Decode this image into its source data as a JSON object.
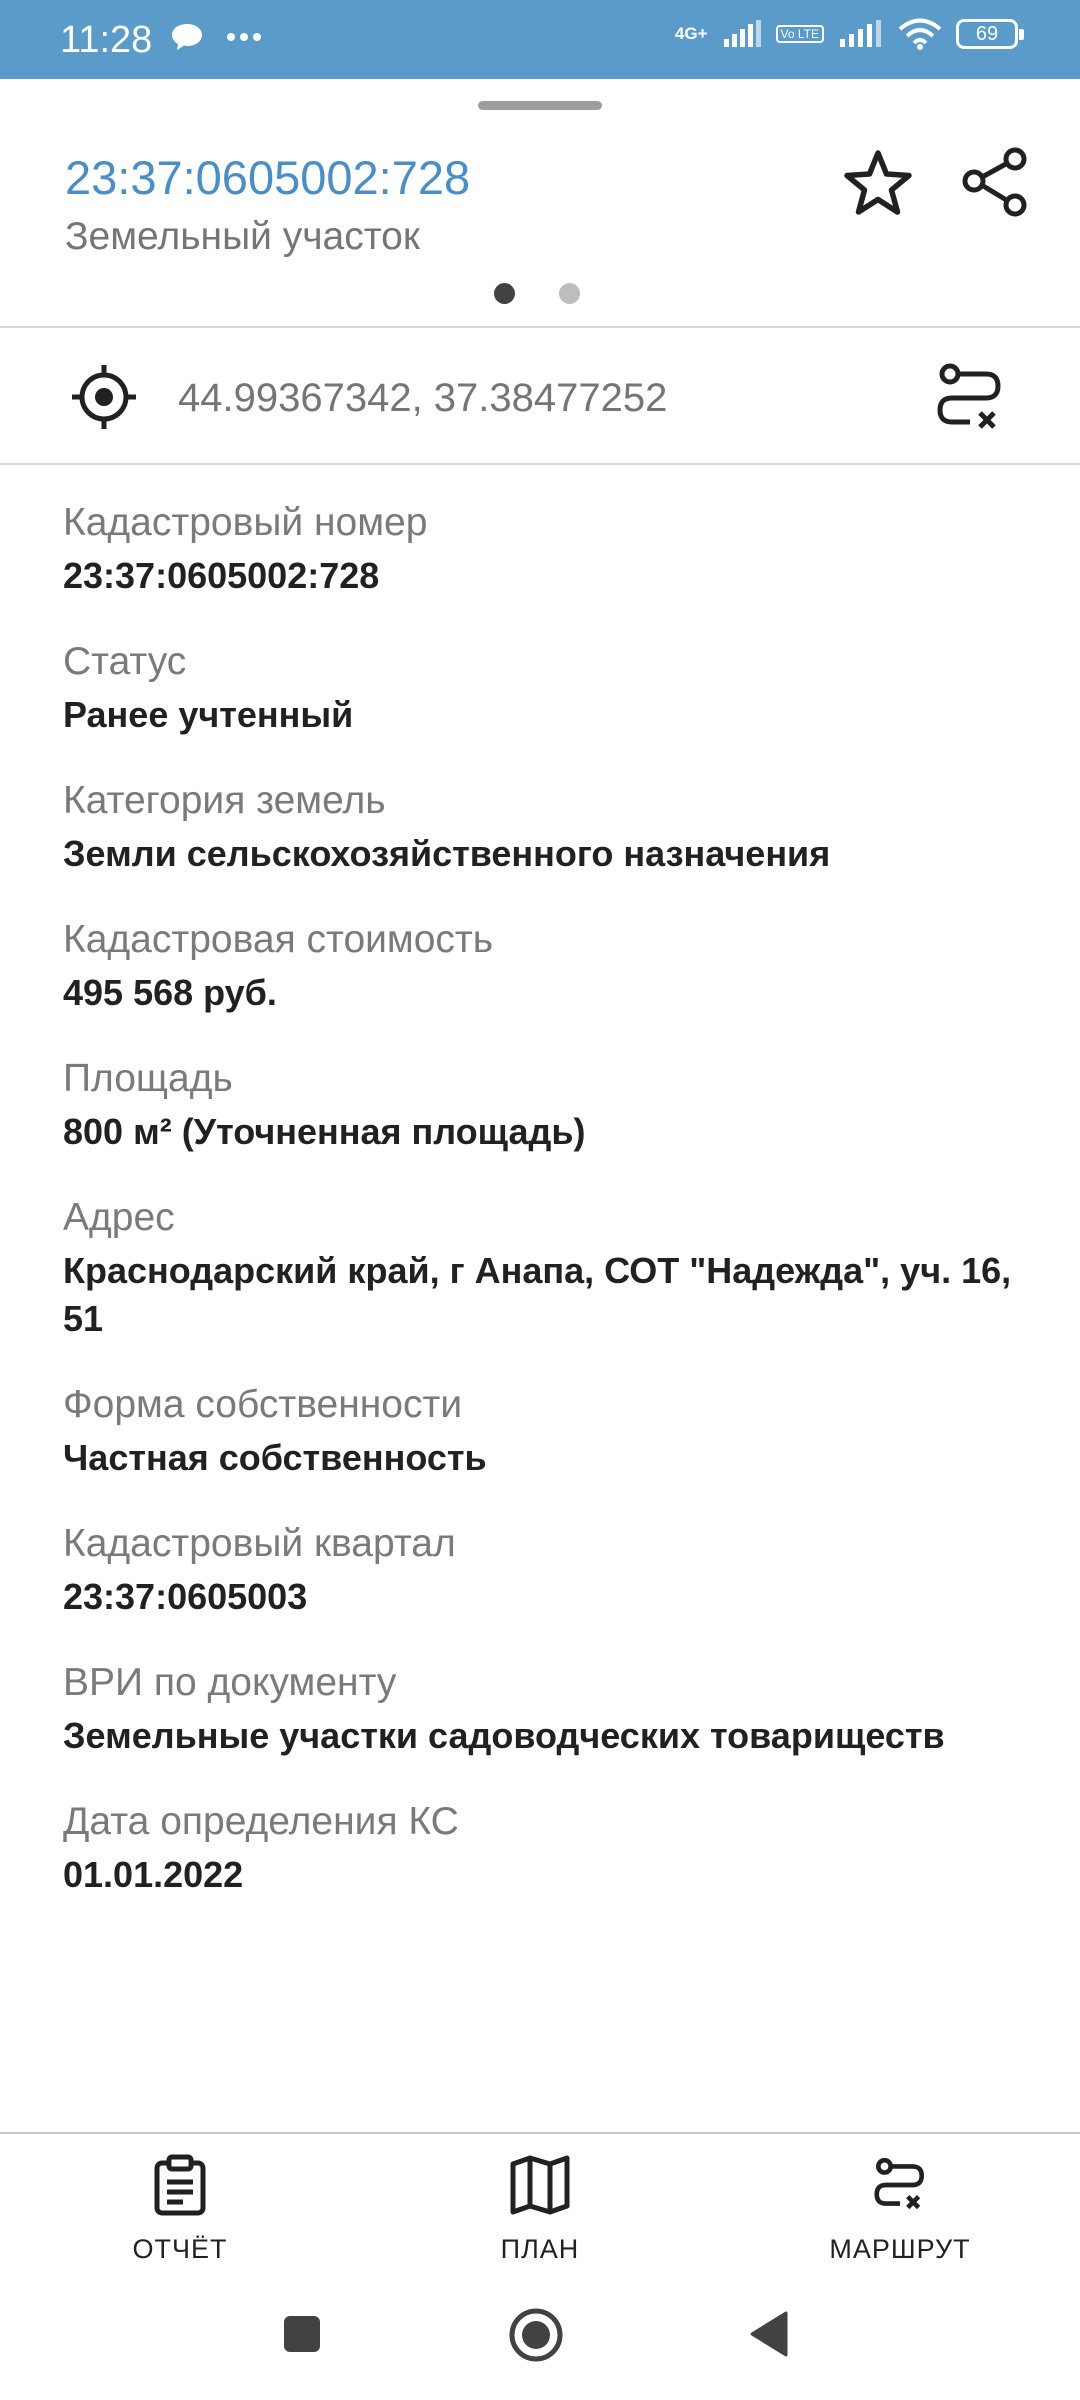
{
  "status_bar": {
    "time": "11:28",
    "network_label": "4G+",
    "volte_label": "Vo LTE",
    "battery": "69"
  },
  "header": {
    "title": "23:37:0605002:728",
    "subtitle": "Земельный участок",
    "pager_total": 2,
    "pager_active": 1
  },
  "location": {
    "coordinates": "44.99367342, 37.38477252"
  },
  "fields": [
    {
      "label": "Кадастровый номер",
      "value": "23:37:0605002:728"
    },
    {
      "label": "Статус",
      "value": "Ранее учтенный"
    },
    {
      "label": "Категория земель",
      "value": "Земли сельскохозяйственного назначения"
    },
    {
      "label": "Кадастровая стоимость",
      "value": "495 568 руб."
    },
    {
      "label": "Площадь",
      "value": "800 м² (Уточненная площадь)"
    },
    {
      "label": "Адрес",
      "value": "Краснодарский край, г Анапа, СОТ \"Надежда\", уч. 16, 51"
    },
    {
      "label": "Форма собственности",
      "value": "Частная собственность"
    },
    {
      "label": "Кадастровый квартал",
      "value": "23:37:0605003"
    },
    {
      "label": "ВРИ по документу",
      "value": "Земельные участки садоводческих товариществ"
    },
    {
      "label": "Дата определения КС",
      "value": "01.01.2022"
    }
  ],
  "bottom_nav": {
    "report_label": "ОТЧЁТ",
    "plan_label": "ПЛАН",
    "route_label": "МАРШРУТ"
  },
  "colors": {
    "status_bar": "#5b9bc9",
    "title_accent": "#4b8ec5"
  },
  "icons": [
    "chat-bubble-icon",
    "more-dots-icon",
    "signal-icon",
    "wifi-icon",
    "battery-icon",
    "star-icon",
    "share-icon",
    "target-location-icon",
    "route-remove-icon",
    "clipboard-report-icon",
    "map-icon",
    "square-icon",
    "circle-home-icon",
    "back-triangle-icon"
  ]
}
